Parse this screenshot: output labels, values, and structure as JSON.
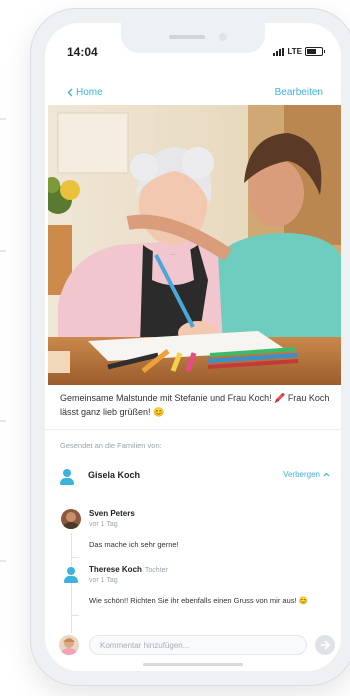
{
  "status_bar": {
    "time": "14:04",
    "network": "LTE"
  },
  "nav": {
    "back_label": "Home",
    "edit_label": "Bearbeiten"
  },
  "post": {
    "caption": "Gemeinsame Malstunde mit Stefanie und Frau Koch! 🖍️ Frau Koch lässt ganz lieb grüßen! 😊",
    "sent_to_label": "Gesendet an die Familien von:"
  },
  "family": {
    "name": "Gisela Koch",
    "hide_label": "Verbergen"
  },
  "comments": [
    {
      "author": "Sven Peters",
      "role": "",
      "time": "vor 1 Tag",
      "text": "Das mache ich sehr gerne!"
    },
    {
      "author": "Therese Koch",
      "role": "Tochter",
      "time": "vor 1 Tag",
      "text": "Wie schön!! Richten Sie ihr ebenfalls einen Gruss von mir aus! 😊"
    }
  ],
  "comment_input": {
    "placeholder": "Kommentar hinzufügen..."
  },
  "colors": {
    "accent": "#3bb3dc",
    "text": "#333333",
    "muted": "#9aa4ad"
  },
  "icons": [
    "chevron-left-icon",
    "chevron-up-icon",
    "person-icon",
    "send-icon",
    "signal-icon",
    "battery-icon"
  ]
}
